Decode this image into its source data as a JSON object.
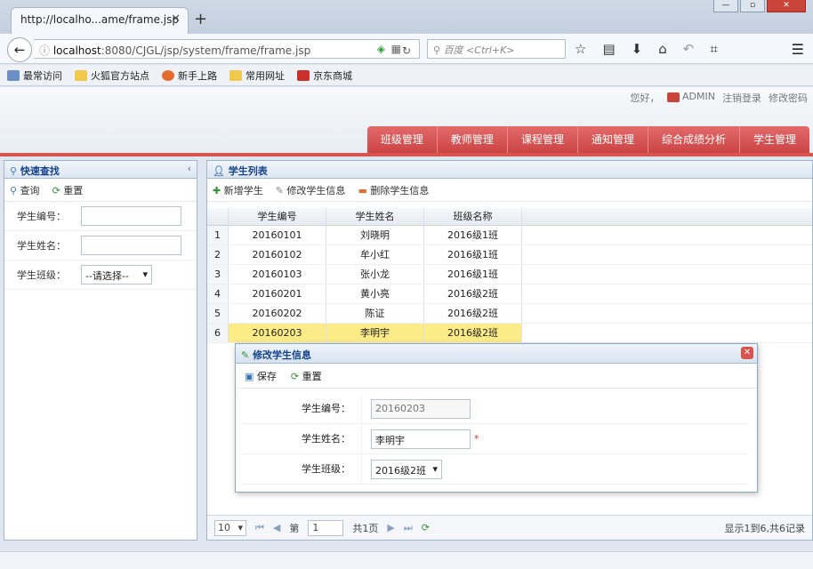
{
  "browser": {
    "tab_title": "http://localho...ame/frame.jsp",
    "url_host": "localhost",
    "url_rest": ":8080/CJGL/jsp/system/frame/frame.jsp",
    "search_placeholder": "百度 <Ctrl+K>",
    "bookmarks": [
      "最常访问",
      "火狐官方站点",
      "新手上路",
      "常用网址",
      "京东商城"
    ]
  },
  "header": {
    "greeting": "您好，",
    "user": "ADMIN",
    "logout": "注销登录",
    "change_password": "修改密码",
    "nav": [
      "班级管理",
      "教师管理",
      "课程管理",
      "通知管理",
      "综合成绩分析",
      "学生管理"
    ]
  },
  "search_panel": {
    "title": "快速查找",
    "query_btn": "查询",
    "reset_btn": "重置",
    "fields": {
      "student_no_label": "学生编号：",
      "student_name_label": "学生姓名：",
      "class_label": "学生班级：",
      "class_value": "--请选择--"
    }
  },
  "list_panel": {
    "title": "学生列表",
    "add_btn": "新增学生",
    "edit_btn": "修改学生信息",
    "delete_btn": "删除学生信息",
    "columns": [
      "学生编号",
      "学生姓名",
      "班级名称"
    ],
    "rows": [
      {
        "n": "1",
        "no": "20160101",
        "name": "刘晓明",
        "cls": "2016级1班"
      },
      {
        "n": "2",
        "no": "20160102",
        "name": "牟小红",
        "cls": "2016级1班"
      },
      {
        "n": "3",
        "no": "20160103",
        "name": "张小龙",
        "cls": "2016级1班"
      },
      {
        "n": "4",
        "no": "20160201",
        "name": "黄小亮",
        "cls": "2016级2班"
      },
      {
        "n": "5",
        "no": "20160202",
        "name": "陈证",
        "cls": "2016级2班"
      },
      {
        "n": "6",
        "no": "20160203",
        "name": "李明宇",
        "cls": "2016级2班"
      }
    ],
    "pager": {
      "page_size": "10",
      "page_prefix": "第",
      "page_value": "1",
      "page_total": "共1页",
      "info": "显示1到6,共6记录"
    }
  },
  "dialog": {
    "title": "修改学生信息",
    "save_btn": "保存",
    "reset_btn": "重置",
    "student_no_label": "学生编号：",
    "student_no_value": "20160203",
    "student_name_label": "学生姓名：",
    "student_name_value": "李明宇",
    "required_mark": "*",
    "class_label": "学生班级：",
    "class_value": "2016级2班"
  }
}
